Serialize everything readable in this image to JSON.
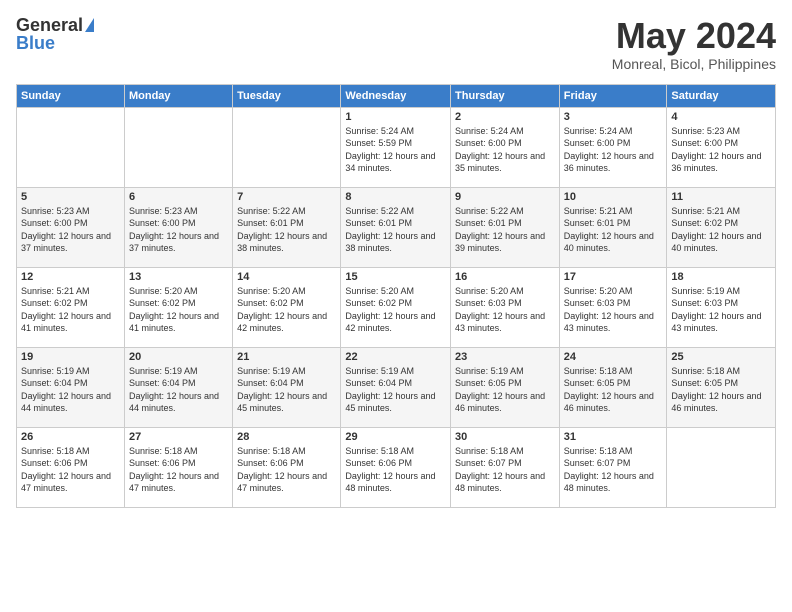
{
  "header": {
    "logo_general": "General",
    "logo_blue": "Blue",
    "title": "May 2024",
    "location": "Monreal, Bicol, Philippines"
  },
  "days_of_week": [
    "Sunday",
    "Monday",
    "Tuesday",
    "Wednesday",
    "Thursday",
    "Friday",
    "Saturday"
  ],
  "weeks": [
    [
      {
        "day": "",
        "sunrise": "",
        "sunset": "",
        "daylight": ""
      },
      {
        "day": "",
        "sunrise": "",
        "sunset": "",
        "daylight": ""
      },
      {
        "day": "",
        "sunrise": "",
        "sunset": "",
        "daylight": ""
      },
      {
        "day": "1",
        "sunrise": "Sunrise: 5:24 AM",
        "sunset": "Sunset: 5:59 PM",
        "daylight": "Daylight: 12 hours and 34 minutes."
      },
      {
        "day": "2",
        "sunrise": "Sunrise: 5:24 AM",
        "sunset": "Sunset: 6:00 PM",
        "daylight": "Daylight: 12 hours and 35 minutes."
      },
      {
        "day": "3",
        "sunrise": "Sunrise: 5:24 AM",
        "sunset": "Sunset: 6:00 PM",
        "daylight": "Daylight: 12 hours and 36 minutes."
      },
      {
        "day": "4",
        "sunrise": "Sunrise: 5:23 AM",
        "sunset": "Sunset: 6:00 PM",
        "daylight": "Daylight: 12 hours and 36 minutes."
      }
    ],
    [
      {
        "day": "5",
        "sunrise": "Sunrise: 5:23 AM",
        "sunset": "Sunset: 6:00 PM",
        "daylight": "Daylight: 12 hours and 37 minutes."
      },
      {
        "day": "6",
        "sunrise": "Sunrise: 5:23 AM",
        "sunset": "Sunset: 6:00 PM",
        "daylight": "Daylight: 12 hours and 37 minutes."
      },
      {
        "day": "7",
        "sunrise": "Sunrise: 5:22 AM",
        "sunset": "Sunset: 6:01 PM",
        "daylight": "Daylight: 12 hours and 38 minutes."
      },
      {
        "day": "8",
        "sunrise": "Sunrise: 5:22 AM",
        "sunset": "Sunset: 6:01 PM",
        "daylight": "Daylight: 12 hours and 38 minutes."
      },
      {
        "day": "9",
        "sunrise": "Sunrise: 5:22 AM",
        "sunset": "Sunset: 6:01 PM",
        "daylight": "Daylight: 12 hours and 39 minutes."
      },
      {
        "day": "10",
        "sunrise": "Sunrise: 5:21 AM",
        "sunset": "Sunset: 6:01 PM",
        "daylight": "Daylight: 12 hours and 40 minutes."
      },
      {
        "day": "11",
        "sunrise": "Sunrise: 5:21 AM",
        "sunset": "Sunset: 6:02 PM",
        "daylight": "Daylight: 12 hours and 40 minutes."
      }
    ],
    [
      {
        "day": "12",
        "sunrise": "Sunrise: 5:21 AM",
        "sunset": "Sunset: 6:02 PM",
        "daylight": "Daylight: 12 hours and 41 minutes."
      },
      {
        "day": "13",
        "sunrise": "Sunrise: 5:20 AM",
        "sunset": "Sunset: 6:02 PM",
        "daylight": "Daylight: 12 hours and 41 minutes."
      },
      {
        "day": "14",
        "sunrise": "Sunrise: 5:20 AM",
        "sunset": "Sunset: 6:02 PM",
        "daylight": "Daylight: 12 hours and 42 minutes."
      },
      {
        "day": "15",
        "sunrise": "Sunrise: 5:20 AM",
        "sunset": "Sunset: 6:02 PM",
        "daylight": "Daylight: 12 hours and 42 minutes."
      },
      {
        "day": "16",
        "sunrise": "Sunrise: 5:20 AM",
        "sunset": "Sunset: 6:03 PM",
        "daylight": "Daylight: 12 hours and 43 minutes."
      },
      {
        "day": "17",
        "sunrise": "Sunrise: 5:20 AM",
        "sunset": "Sunset: 6:03 PM",
        "daylight": "Daylight: 12 hours and 43 minutes."
      },
      {
        "day": "18",
        "sunrise": "Sunrise: 5:19 AM",
        "sunset": "Sunset: 6:03 PM",
        "daylight": "Daylight: 12 hours and 43 minutes."
      }
    ],
    [
      {
        "day": "19",
        "sunrise": "Sunrise: 5:19 AM",
        "sunset": "Sunset: 6:04 PM",
        "daylight": "Daylight: 12 hours and 44 minutes."
      },
      {
        "day": "20",
        "sunrise": "Sunrise: 5:19 AM",
        "sunset": "Sunset: 6:04 PM",
        "daylight": "Daylight: 12 hours and 44 minutes."
      },
      {
        "day": "21",
        "sunrise": "Sunrise: 5:19 AM",
        "sunset": "Sunset: 6:04 PM",
        "daylight": "Daylight: 12 hours and 45 minutes."
      },
      {
        "day": "22",
        "sunrise": "Sunrise: 5:19 AM",
        "sunset": "Sunset: 6:04 PM",
        "daylight": "Daylight: 12 hours and 45 minutes."
      },
      {
        "day": "23",
        "sunrise": "Sunrise: 5:19 AM",
        "sunset": "Sunset: 6:05 PM",
        "daylight": "Daylight: 12 hours and 46 minutes."
      },
      {
        "day": "24",
        "sunrise": "Sunrise: 5:18 AM",
        "sunset": "Sunset: 6:05 PM",
        "daylight": "Daylight: 12 hours and 46 minutes."
      },
      {
        "day": "25",
        "sunrise": "Sunrise: 5:18 AM",
        "sunset": "Sunset: 6:05 PM",
        "daylight": "Daylight: 12 hours and 46 minutes."
      }
    ],
    [
      {
        "day": "26",
        "sunrise": "Sunrise: 5:18 AM",
        "sunset": "Sunset: 6:06 PM",
        "daylight": "Daylight: 12 hours and 47 minutes."
      },
      {
        "day": "27",
        "sunrise": "Sunrise: 5:18 AM",
        "sunset": "Sunset: 6:06 PM",
        "daylight": "Daylight: 12 hours and 47 minutes."
      },
      {
        "day": "28",
        "sunrise": "Sunrise: 5:18 AM",
        "sunset": "Sunset: 6:06 PM",
        "daylight": "Daylight: 12 hours and 47 minutes."
      },
      {
        "day": "29",
        "sunrise": "Sunrise: 5:18 AM",
        "sunset": "Sunset: 6:06 PM",
        "daylight": "Daylight: 12 hours and 48 minutes."
      },
      {
        "day": "30",
        "sunrise": "Sunrise: 5:18 AM",
        "sunset": "Sunset: 6:07 PM",
        "daylight": "Daylight: 12 hours and 48 minutes."
      },
      {
        "day": "31",
        "sunrise": "Sunrise: 5:18 AM",
        "sunset": "Sunset: 6:07 PM",
        "daylight": "Daylight: 12 hours and 48 minutes."
      },
      {
        "day": "",
        "sunrise": "",
        "sunset": "",
        "daylight": ""
      }
    ]
  ]
}
